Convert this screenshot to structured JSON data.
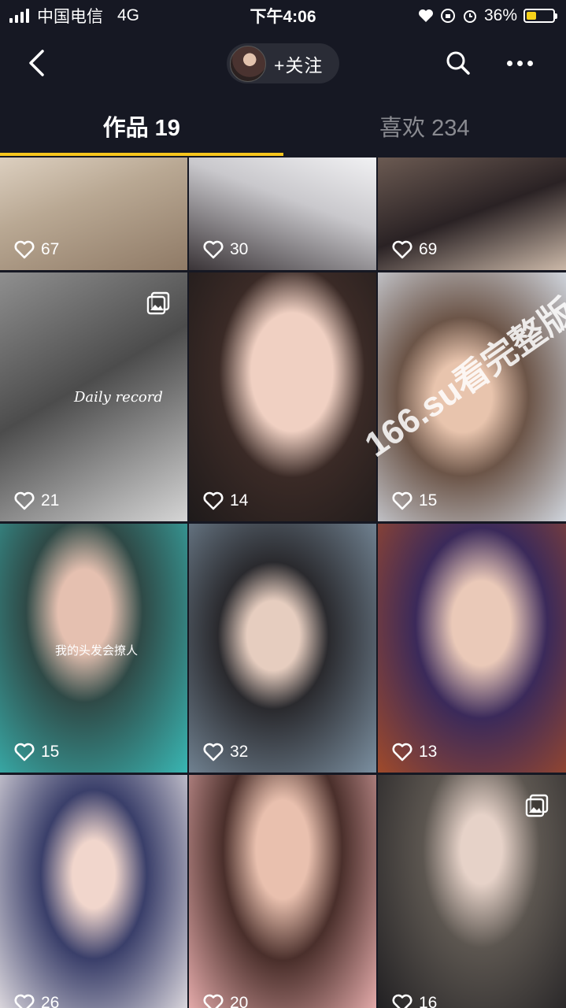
{
  "status_bar": {
    "carrier": "中国电信",
    "network": "4G",
    "time": "下午4:06",
    "battery_percent": "36%",
    "battery_level": 0.36,
    "icons": [
      "signal-icon",
      "heart-icon",
      "orientation-lock-icon",
      "alarm-icon",
      "battery-icon"
    ]
  },
  "nav": {
    "follow_label": "+关注",
    "icons": [
      "back-arrow-icon",
      "search-icon",
      "more-icon"
    ]
  },
  "tabs": [
    {
      "label": "作品 19",
      "active": true
    },
    {
      "label": "喜欢 234",
      "active": false
    }
  ],
  "accent_color": "#f7c51c",
  "grid": {
    "items": [
      {
        "likes": "67"
      },
      {
        "likes": "30"
      },
      {
        "likes": "69"
      },
      {
        "likes": "21",
        "overlay": "Daily record",
        "multi_image": true
      },
      {
        "likes": "14"
      },
      {
        "likes": "15"
      },
      {
        "likes": "15",
        "overlay": "我的头发会撩人"
      },
      {
        "likes": "32"
      },
      {
        "likes": "13"
      },
      {
        "likes": "26"
      },
      {
        "likes": "20"
      },
      {
        "likes": "16",
        "multi_image": true
      }
    ]
  },
  "watermark": "166.su看完整版"
}
